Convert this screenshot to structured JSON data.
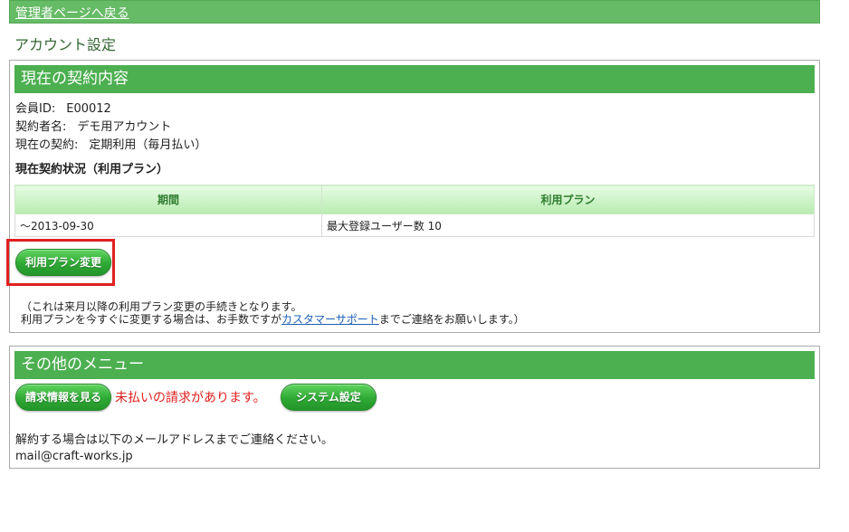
{
  "topbar": {
    "back_link": "管理者ページへ戻る"
  },
  "page": {
    "title": "アカウント設定"
  },
  "contract": {
    "header": "現在の契約内容",
    "member_id_label": "会員ID:",
    "member_id_value": "E00012",
    "contractor_label": "契約者名:",
    "contractor_value": "デモ用アカウント",
    "contract_label": "現在の契約:",
    "contract_value": "定期利用（毎月払い）",
    "status_title": "現在契約状況（利用プラン）",
    "table": {
      "headers": [
        "期間",
        "利用プラン"
      ],
      "rows": [
        [
          "～2013-09-30",
          "最大登録ユーザー数 10"
        ]
      ]
    },
    "change_plan_button": "利用プラン変更",
    "note_line1": "（これは来月以降の利用プラン変更の手続きとなります。",
    "note_line2_prefix": "利用プランを今すぐに変更する場合は、お手数ですが",
    "note_link": "カスタマーサポート",
    "note_line2_suffix": "までご連絡をお願いします。）"
  },
  "other_menu": {
    "header": "その他のメニュー",
    "billing_button": "請求情報を見る",
    "unpaid_warning": "未払いの請求があります。",
    "system_button": "システム設定",
    "cancel_text": "解約する場合は以下のメールアドレスまでご連絡ください。",
    "email": "mail@craft-works.jp"
  },
  "colors": {
    "header_green": "#4caf50",
    "topbar_green": "#66bb66",
    "warning_red": "#e02020",
    "link_blue": "#1a5fb4"
  }
}
